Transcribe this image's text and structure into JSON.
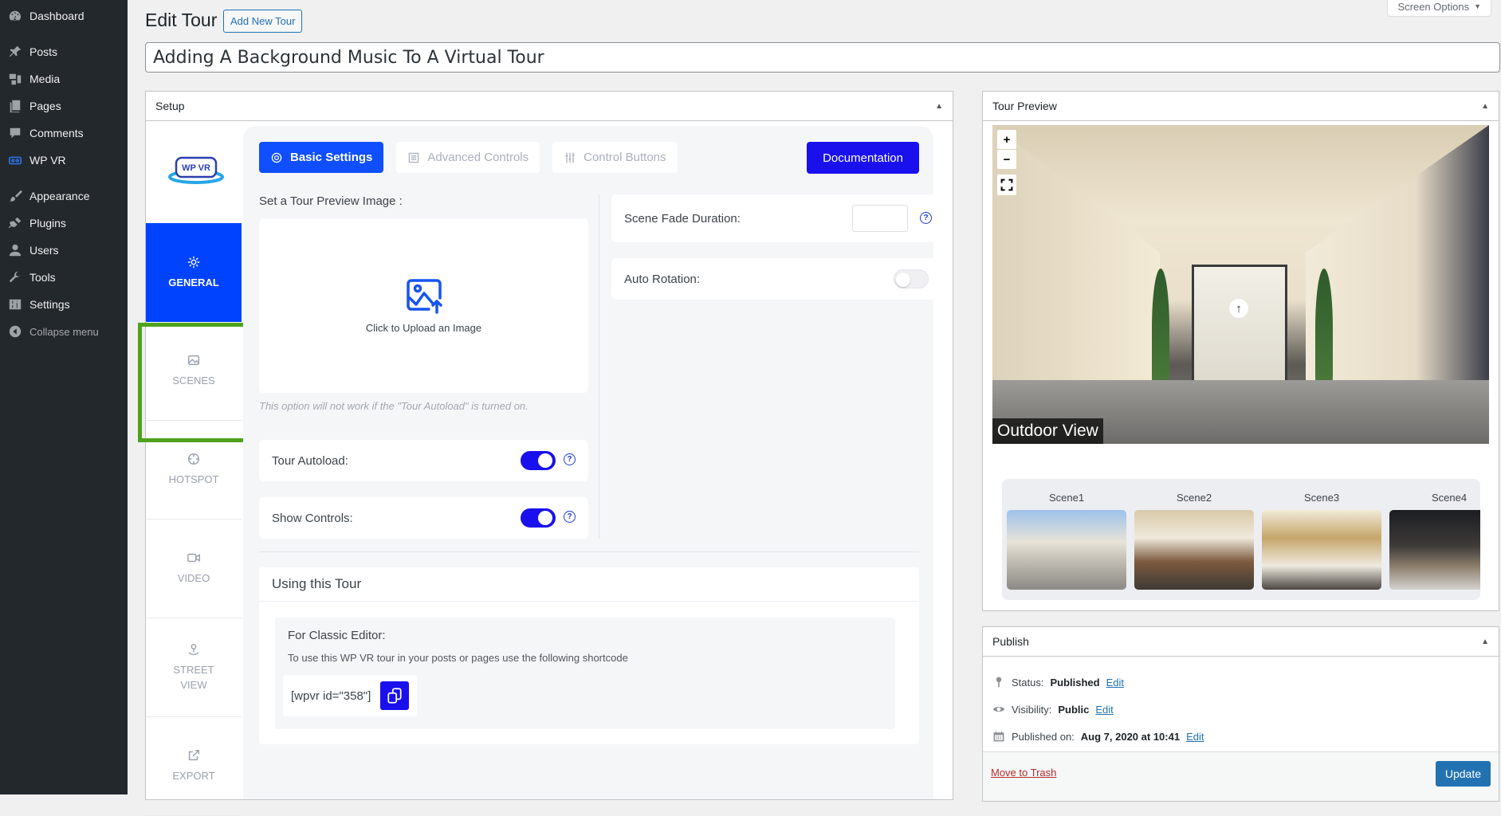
{
  "admin_menu": {
    "items": [
      {
        "label": "Dashboard",
        "icon": "dashboard-icon"
      },
      {
        "label": "Posts",
        "icon": "pin-icon"
      },
      {
        "label": "Media",
        "icon": "media-icon"
      },
      {
        "label": "Pages",
        "icon": "pages-icon"
      },
      {
        "label": "Comments",
        "icon": "comment-icon"
      },
      {
        "label": "WP VR",
        "icon": "vr-headset-icon"
      },
      {
        "label": "Appearance",
        "icon": "paintbrush-icon"
      },
      {
        "label": "Plugins",
        "icon": "plug-icon"
      },
      {
        "label": "Users",
        "icon": "user-icon"
      },
      {
        "label": "Tools",
        "icon": "wrench-icon"
      },
      {
        "label": "Settings",
        "icon": "sliders-icon"
      }
    ],
    "collapse_label": "Collapse menu"
  },
  "header": {
    "screen_options": "Screen Options",
    "title": "Edit Tour",
    "add_new": "Add New Tour",
    "tour_title": "Adding A Background Music To A Virtual Tour"
  },
  "setup": {
    "title": "Setup",
    "logo_text": "WP VR",
    "nav": [
      {
        "label": "GENERAL",
        "icon": "gear-icon",
        "active": true
      },
      {
        "label": "SCENES",
        "icon": "image-icon"
      },
      {
        "label": "HOTSPOT",
        "icon": "crosshair-icon"
      },
      {
        "label": "VIDEO",
        "icon": "video-icon"
      },
      {
        "label": "STREET",
        "label2": "VIEW",
        "icon": "street-view-icon"
      },
      {
        "label": "EXPORT",
        "icon": "external-link-icon"
      }
    ],
    "tabs": [
      {
        "label": "Basic Settings",
        "icon": "gear-icon",
        "active": true
      },
      {
        "label": "Advanced Controls",
        "icon": "list-icon"
      },
      {
        "label": "Control Buttons",
        "icon": "sliders-icon"
      }
    ],
    "documentation": "Documentation",
    "preview_image_label": "Set a Tour Preview Image :",
    "upload_text": "Click to Upload an Image",
    "hint": "This option will not work if the \"Tour Autoload\" is turned on.",
    "tour_autoload": {
      "label": "Tour Autoload:",
      "on": true
    },
    "show_controls": {
      "label": "Show Controls:",
      "on": true
    },
    "scene_fade": {
      "label": "Scene Fade Duration:",
      "value": ""
    },
    "auto_rotation": {
      "label": "Auto Rotation:",
      "on": false
    },
    "help_glyph": "?",
    "usage": {
      "title": "Using this Tour",
      "classic_title": "For Classic Editor:",
      "classic_desc": "To use this WP VR tour in your posts or pages use the following shortcode",
      "shortcode": "[wpvr id=\"358\"]"
    }
  },
  "preview": {
    "title": "Tour Preview",
    "zoom_in": "+",
    "zoom_out": "−",
    "scene_title": "Outdoor View",
    "hotspot_glyph": "↑",
    "scenes": [
      {
        "label": "Scene1"
      },
      {
        "label": "Scene2"
      },
      {
        "label": "Scene3"
      },
      {
        "label": "Scene4"
      }
    ]
  },
  "publish": {
    "title": "Publish",
    "status_label": "Status:",
    "status_value": "Published",
    "visibility_label": "Visibility:",
    "visibility_value": "Public",
    "published_label": "Published on:",
    "published_value": "Aug 7, 2020 at 10:41",
    "edit": "Edit",
    "trash": "Move to Trash",
    "update": "Update"
  },
  "colors": {
    "accent": "#0043ff",
    "primary_button": "#1a10ee",
    "wp_blue": "#2271b1",
    "highlight": "#4fa21b"
  }
}
